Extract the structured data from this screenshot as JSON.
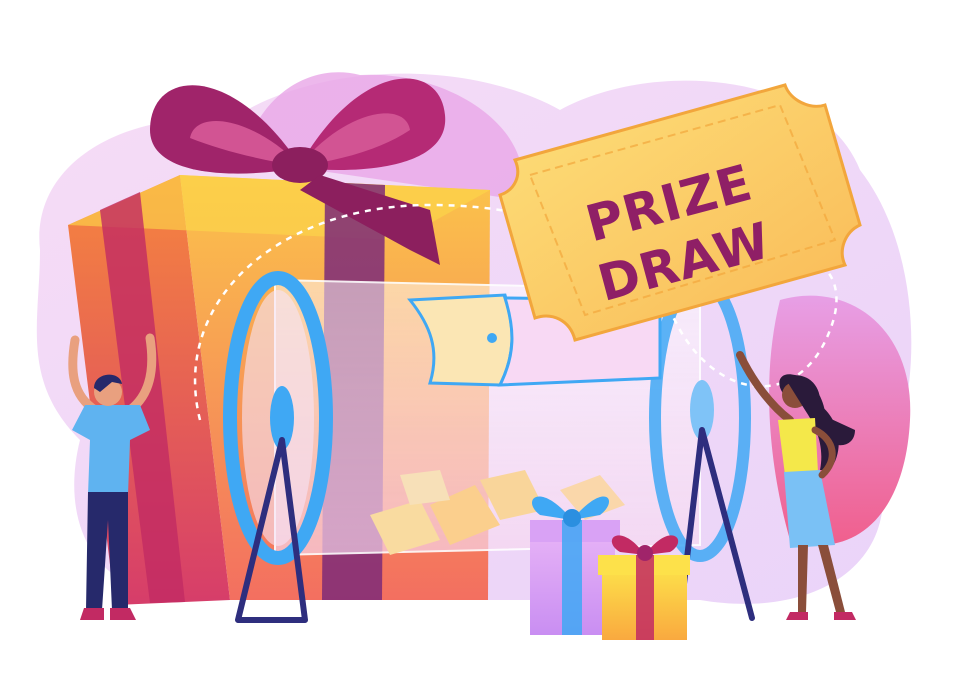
{
  "ticket": {
    "line1": "PRIZE",
    "line2": "DRAW"
  },
  "colors": {
    "background_blob": "#efd6f7",
    "background_blob_deep": "#e39be6",
    "gift_front": "#f7a734",
    "gift_side": "#e35a74",
    "gift_top": "#fcd64a",
    "ribbon": "#a0246a",
    "ticket_fill": "#fbd35f",
    "ticket_text": "#8f1f66",
    "drum_rim": "#3fa8f4",
    "stand": "#2e2e7e",
    "man_shirt": "#5fb3f0",
    "man_pants": "#26296b",
    "woman_top": "#f4e84a",
    "woman_skirt": "#7ac1f5",
    "skin": "#8a4e3a"
  },
  "icons": [
    "gift-box-icon",
    "ribbon-bow-icon",
    "prize-ticket-icon",
    "lottery-drum-icon",
    "small-gift-icon"
  ]
}
